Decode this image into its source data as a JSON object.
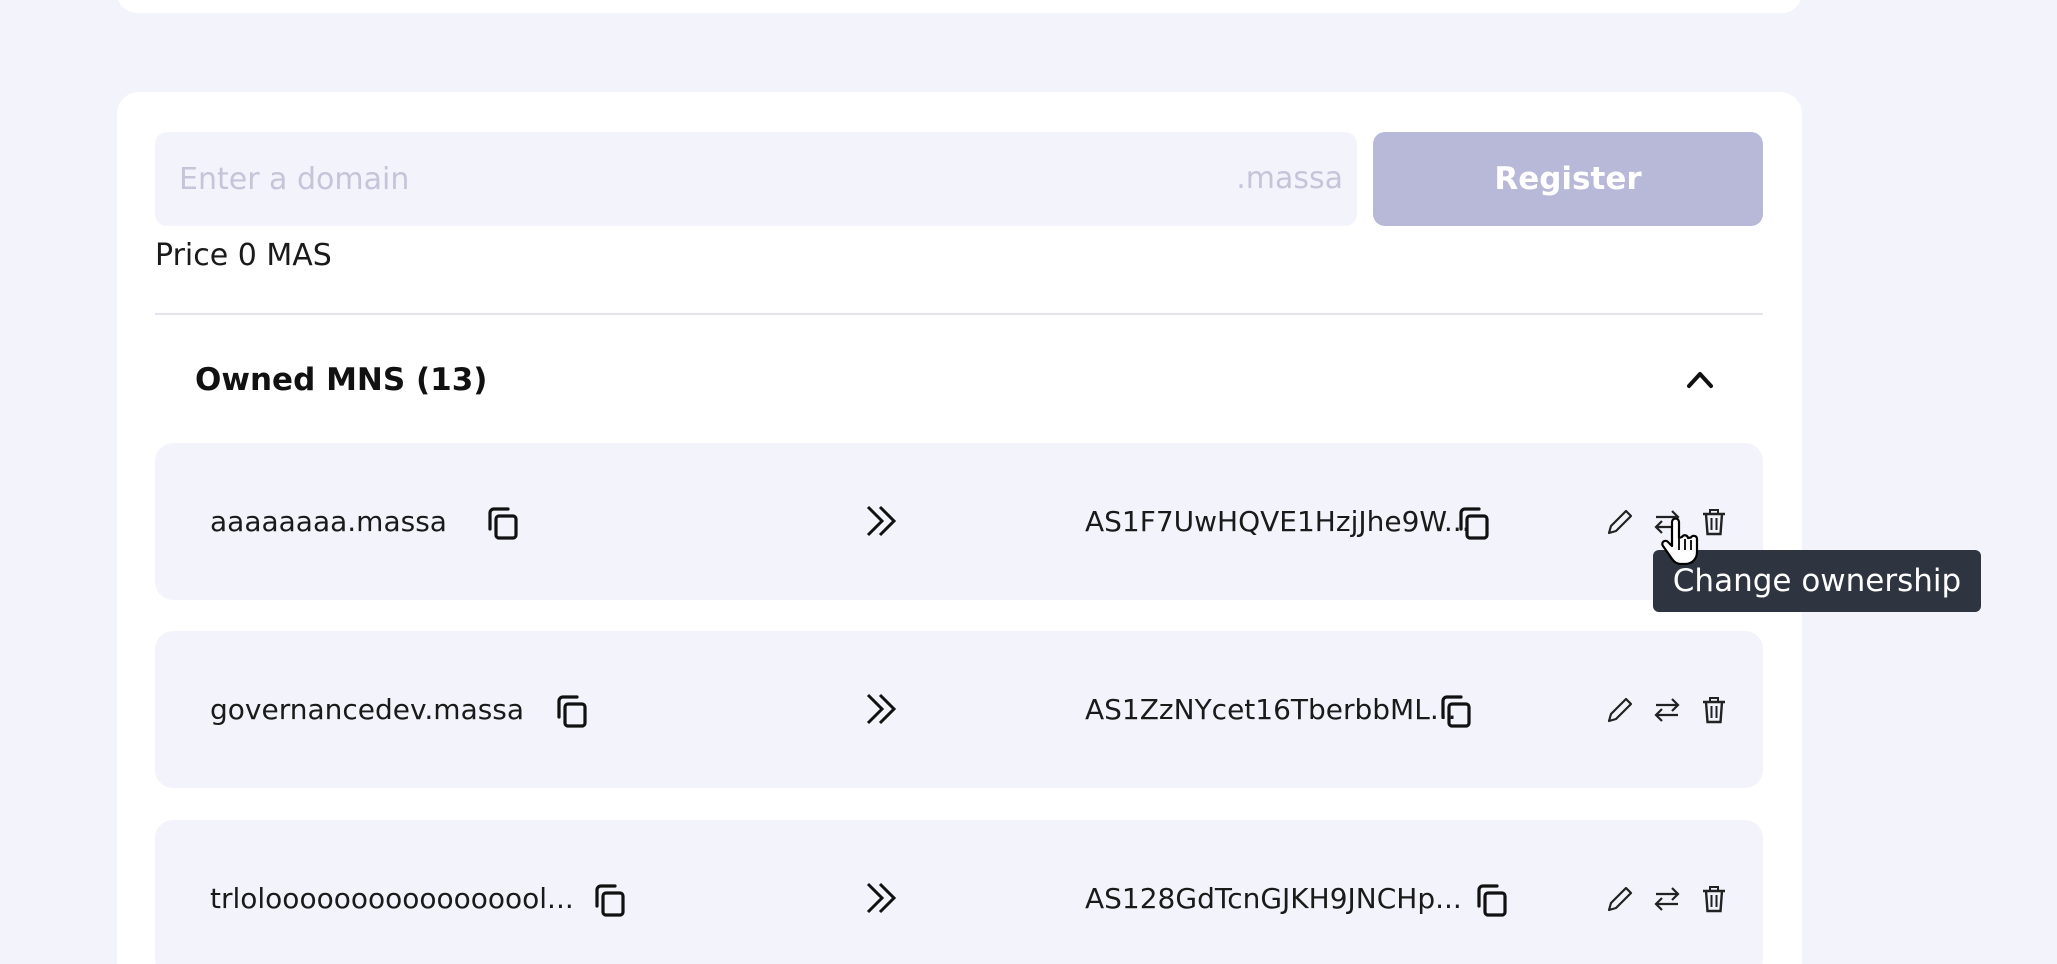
{
  "register": {
    "placeholder": "Enter a domain",
    "suffix": ".massa",
    "button_label": "Register",
    "price_text": "Price 0 MAS"
  },
  "owned": {
    "title": "Owned MNS (13)",
    "rows": [
      {
        "domain": "aaaaaaaa.massa",
        "address": "AS1F7UwHQVE1HzjJhe9W..."
      },
      {
        "domain": "governancedev.massa",
        "address": "AS1ZzNYcet16TberbbML..."
      },
      {
        "domain": "trlolooooooooooooooool...",
        "address": "AS128GdTcnGJKH9JNCHp..."
      }
    ]
  },
  "tooltip": {
    "text": "Change ownership"
  },
  "icons": {
    "copy": "copy-icon",
    "arrow": "double-chevron-right-icon",
    "edit": "pencil-icon",
    "transfer": "swap-arrows-icon",
    "delete": "trash-icon",
    "collapse": "chevron-up-icon"
  },
  "colors": {
    "background": "#f3f3fb",
    "card": "#ffffff",
    "register_button": "#b8b8d8",
    "tooltip": "#2f3540"
  }
}
